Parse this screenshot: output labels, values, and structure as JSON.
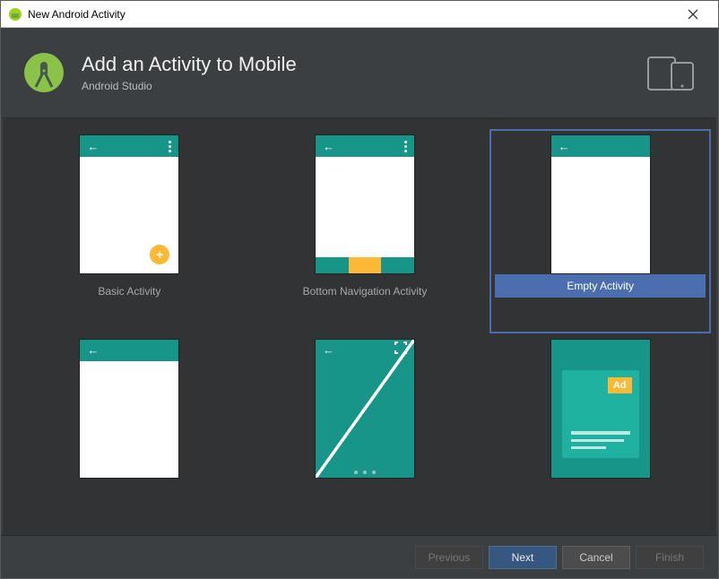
{
  "window": {
    "title": "New Android Activity"
  },
  "header": {
    "title": "Add an Activity to Mobile",
    "subtitle": "Android Studio"
  },
  "templates": [
    {
      "label": "Basic Activity",
      "selected": false
    },
    {
      "label": "Bottom Navigation Activity",
      "selected": false
    },
    {
      "label": "Empty Activity",
      "selected": true
    },
    {
      "label": "",
      "selected": false
    },
    {
      "label": "",
      "selected": false
    },
    {
      "label": "",
      "selected": false
    }
  ],
  "ad_label": "Ad",
  "buttons": {
    "previous": "Previous",
    "next": "Next",
    "cancel": "Cancel",
    "finish": "Finish"
  }
}
